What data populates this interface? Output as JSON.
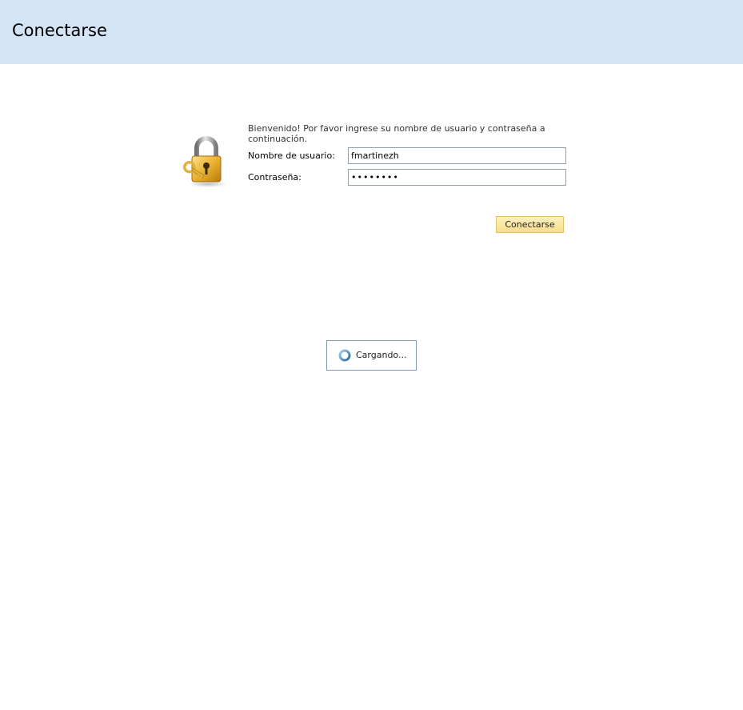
{
  "header": {
    "title": "Conectarse"
  },
  "login": {
    "welcome_text": "Bienvenido! Por favor ingrese su nombre de usuario y contraseña a continuación.",
    "username_label": "Nombre de usuario:",
    "username_value": "fmartinezh",
    "password_label": "Contraseña:",
    "password_value": "abcdefgh",
    "submit_label": "Conectarse",
    "icon": "lock-with-key-icon"
  },
  "loading": {
    "text": "Cargando...",
    "icon": "spinner-icon"
  },
  "colors": {
    "header_bg": "#d3e4f6",
    "field_border": "#8aa0b4",
    "button_bg": "#f7de89",
    "button_border": "#e1c26a"
  }
}
